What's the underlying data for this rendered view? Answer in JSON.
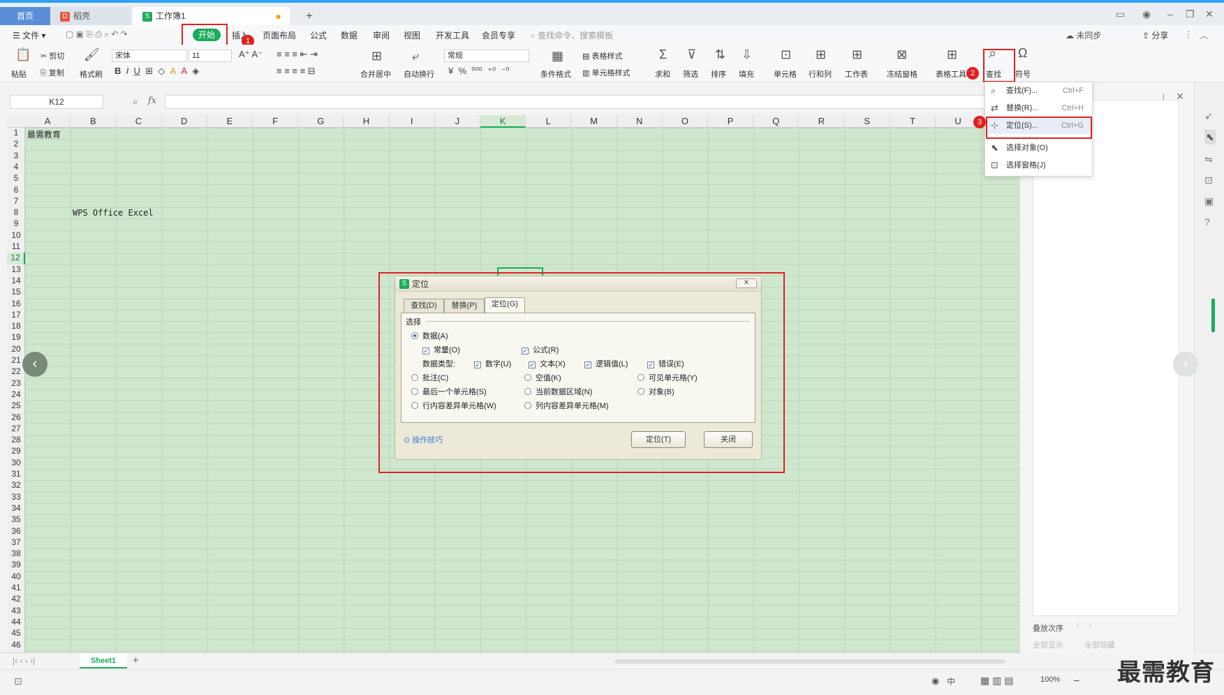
{
  "tabs": {
    "home": "首页",
    "draft": "稻壳",
    "workbook": "工作簿1",
    "new_tab": "+"
  },
  "menu": {
    "file": "文件",
    "start": "开始",
    "insert": "插入",
    "page_layout": "页面布局",
    "formula": "公式",
    "data": "数据",
    "review": "审阅",
    "view": "视图",
    "dev_tools": "开发工具",
    "member": "会员专享",
    "search_placeholder": "查找命令、搜索模板",
    "share": "分享",
    "cloud": "未同步"
  },
  "toolbar": {
    "paste": "粘贴",
    "cut": "剪切",
    "copy": "复制",
    "format_painter": "格式刷",
    "font_name": "宋体",
    "font_size": "11",
    "merge_center": "合并居中",
    "auto_wrap": "自动换行",
    "number_format": "常规",
    "cond_format": "条件格式",
    "table_style": "表格样式",
    "cell_style": "单元格样式",
    "sum": "求和",
    "filter": "筛选",
    "sort": "排序",
    "fill": "填充",
    "cell": "单元格",
    "row_col": "行和列",
    "worksheet": "工作表",
    "freeze": "冻结窗格",
    "table_tools": "表格工具",
    "find": "查找",
    "symbol": "符号"
  },
  "formula_bar": {
    "name_box": "K12",
    "fx": "fx"
  },
  "columns": [
    "A",
    "B",
    "C",
    "D",
    "E",
    "F",
    "G",
    "H",
    "I",
    "J",
    "K",
    "L",
    "M",
    "N",
    "O",
    "P",
    "Q",
    "R",
    "S",
    "T",
    "U"
  ],
  "selected_column": "K",
  "selected_row": "12",
  "cells": {
    "a1": "最需教育",
    "b8": "WPS Office Excel"
  },
  "find_menu": {
    "find": "查找(F)...",
    "find_sc": "Ctrl+F",
    "replace": "替换(R)...",
    "replace_sc": "Ctrl+H",
    "goto": "定位(S)...",
    "goto_sc": "Ctrl+G",
    "select_obj": "选择对象(O)",
    "select_pane": "选择窗格(J)"
  },
  "dialog": {
    "title": "定位",
    "tab_find": "查找(D)",
    "tab_replace": "替换(P)",
    "tab_goto": "定位(G)",
    "group": "选择",
    "data": "数据(A)",
    "constant": "常量(O)",
    "formula": "公式(R)",
    "data_type": "数据类型:",
    "number": "数字(U)",
    "text": "文本(X)",
    "logical": "逻辑值(L)",
    "error": "错误(E)",
    "comment": "批注(C)",
    "blank": "空值(K)",
    "visible": "可见单元格(Y)",
    "last_cell": "最后一个单元格(S)",
    "current_region": "当前数据区域(N)",
    "object": "对象(B)",
    "row_diff": "行内容差异单元格(W)",
    "col_diff": "列内容差异单元格(M)",
    "tips": "操作技巧",
    "ok": "定位(T)",
    "close": "关闭"
  },
  "steps": [
    "1",
    "2",
    "3"
  ],
  "sheet": {
    "name": "Sheet1"
  },
  "right_panel": {
    "stack_order": "叠放次序",
    "show_all": "全部显示",
    "hide_all": "全部隐藏"
  },
  "status": {
    "zoom": "100%",
    "ime": "中"
  },
  "watermark": "最需教育",
  "colors": {
    "accent": "#1cab5a",
    "highlight_box": "#e02020",
    "grid_bg": "#cfe7cf"
  }
}
